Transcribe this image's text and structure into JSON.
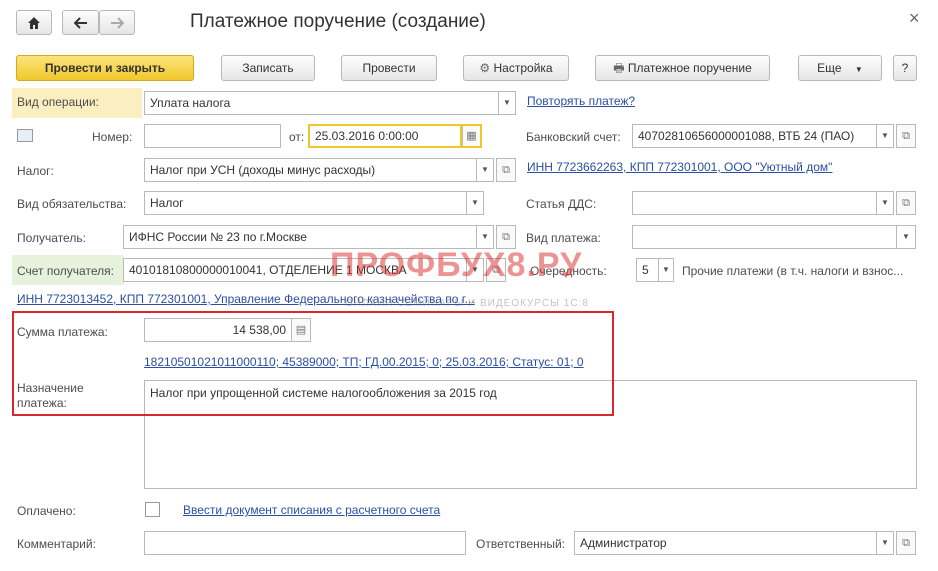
{
  "window": {
    "title": "Платежное поручение (создание)",
    "home_icon": "home-icon",
    "back_icon": "arrow-left-icon",
    "forward_icon": "arrow-right-icon",
    "close_glyph": "×"
  },
  "toolbar": {
    "post_close": "Провести и закрыть",
    "save": "Записать",
    "post": "Провести",
    "settings": "Настройка",
    "print": "Платежное поручение",
    "more": "Еще",
    "help": "?"
  },
  "form": {
    "op_type_label": "Вид операции:",
    "op_type_value": "Уплата налога",
    "repeat_link": "Повторять платеж?",
    "number_label": "Номер:",
    "number_value": "",
    "date_from_label": "от:",
    "date_value": "25.03.2016  0:00:00",
    "bank_account_label": "Банковский счет:",
    "bank_account_value": "40702810656000001088, ВТБ 24 (ПАО)",
    "tax_label": "Налог:",
    "tax_value": "Налог при УСН (доходы минус расходы)",
    "org_link": "ИНН 7723662263, КПП 772301001, ООО \"Уютный дом\"",
    "obligation_label": "Вид обязательства:",
    "obligation_value": "Налог",
    "dds_label": "Статья ДДС:",
    "dds_value": "",
    "recipient_label": "Получатель:",
    "recipient_value": "ИФНС России № 23 по г.Москве",
    "payment_kind_label": "Вид платежа:",
    "payment_kind_value": "",
    "recipient_account_label": "Счет получателя:",
    "recipient_account_value": "40101810800000010041, ОТДЕЛЕНИЕ 1 МОСКВА",
    "priority_label": "Очередность:",
    "priority_value": "5",
    "priority_desc": "Прочие платежи (в т.ч. налоги и взнос...",
    "recipient_link": "ИНН 7723013452, КПП 772301001, Управление Федерального казначейства по г...",
    "amount_label": "Сумма платежа:",
    "amount_value": "14 538,00",
    "budget_link": "18210501021011000110; 45389000; ТП; ГД.00.2015; 0; 25.03.2016; Статус: 01; 0",
    "purpose_label": "Назначение платежа:",
    "purpose_value": "Налог при упрощенной системе налогообложения за 2015 год",
    "paid_label": "Оплачено:",
    "writeoff_link": "Ввести документ списания с расчетного счета",
    "comment_label": "Комментарий:",
    "comment_value": "",
    "responsible_label": "Ответственный:",
    "responsible_value": "Администратор"
  },
  "watermark": {
    "main": "ПРОФБУХ8.РУ",
    "sub": "ОНЛАЙН СЕМИНАРЫ И ВИДЕОКУРСЫ 1С:8"
  },
  "colors": {
    "accent_yellow": "#f0c82c",
    "highlight_yellow": "#fbeec0",
    "highlight_green": "#e6f2dc",
    "link_blue": "#2a4fa3",
    "annotation_red": "#d8282e"
  }
}
